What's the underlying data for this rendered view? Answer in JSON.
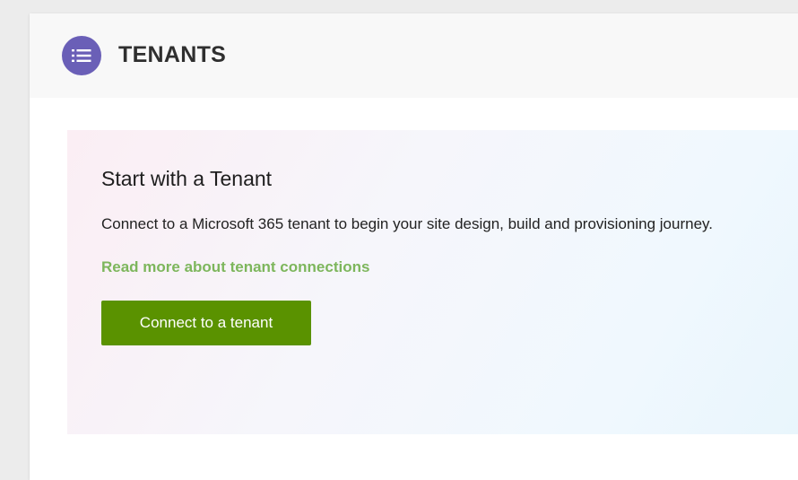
{
  "header": {
    "title": "TENANTS",
    "icon": "list-icon",
    "icon_bg": "#6a5fb7"
  },
  "tenant_panel": {
    "title": "Start with a Tenant",
    "description": "Connect to a Microsoft 365 tenant to begin your site design, build and provisioning journey.",
    "link_label": "Read more about tenant connections",
    "link_color": "#7db65c",
    "button_label": "Connect to a tenant",
    "button_color": "#5a9200"
  }
}
